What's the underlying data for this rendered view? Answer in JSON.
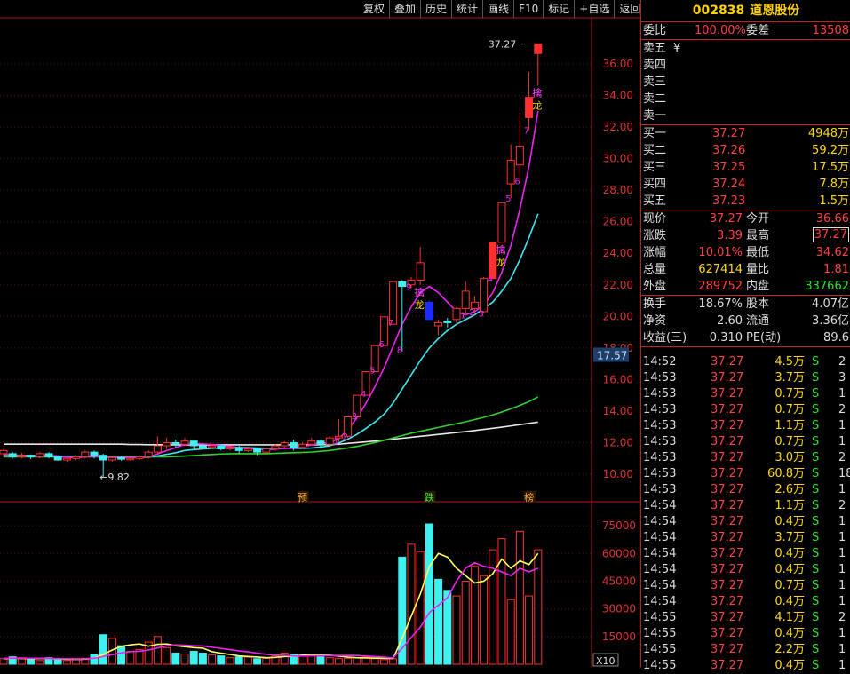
{
  "toolbar": {
    "items": [
      "复权",
      "叠加",
      "历史",
      "统计",
      "画线",
      "F10",
      "标记",
      "+自选",
      "返回"
    ]
  },
  "stock": {
    "code": "002838",
    "name": "道恩股份",
    "weibi_label": "委比",
    "weibi": "100.00%",
    "weicha_label": "委差",
    "weicha": "13508",
    "sell": [
      {
        "label": "卖五",
        "price": "",
        "vol": "",
        "mark": "¥"
      },
      {
        "label": "卖四",
        "price": "",
        "vol": ""
      },
      {
        "label": "卖三",
        "price": "",
        "vol": ""
      },
      {
        "label": "卖二",
        "price": "",
        "vol": ""
      },
      {
        "label": "卖一",
        "price": "",
        "vol": ""
      }
    ],
    "buy": [
      {
        "label": "买一",
        "price": "37.27",
        "vol": "4948万"
      },
      {
        "label": "买二",
        "price": "37.26",
        "vol": "59.2万"
      },
      {
        "label": "买三",
        "price": "37.25",
        "vol": "17.5万"
      },
      {
        "label": "买四",
        "price": "37.24",
        "vol": "7.8万"
      },
      {
        "label": "买五",
        "price": "37.23",
        "vol": "1.5万"
      }
    ],
    "stats": [
      {
        "l1": "现价",
        "v1": "37.27",
        "l2": "今开",
        "v2": "36.66",
        "c1": "red",
        "c2": "red"
      },
      {
        "l1": "涨跌",
        "v1": "3.39",
        "l2": "最高",
        "v2": "37.27",
        "c1": "red",
        "c2": "red",
        "boxed2": true
      },
      {
        "l1": "涨幅",
        "v1": "10.01%",
        "l2": "最低",
        "v2": "34.62",
        "c1": "red",
        "c2": "red"
      },
      {
        "l1": "总量",
        "v1": "627414",
        "l2": "量比",
        "v2": "1.81",
        "c1": "yel",
        "c2": "red"
      },
      {
        "l1": "外盘",
        "v1": "289752",
        "l2": "内盘",
        "v2": "337662",
        "c1": "red",
        "c2": "grn"
      }
    ],
    "stats2": [
      {
        "l1": "换手",
        "v1": "18.67%",
        "l2": "股本",
        "v2": "4.07亿"
      },
      {
        "l1": "净资",
        "v1": "2.60",
        "l2": "流通",
        "v2": "3.36亿"
      },
      {
        "l1": "收益(三)",
        "v1": "0.310",
        "l2": "PE(动)",
        "v2": "89.6"
      }
    ],
    "trades": [
      {
        "t": "14:52",
        "p": "37.27",
        "v": "4.5万",
        "s": "S",
        "n": "2"
      },
      {
        "t": "14:53",
        "p": "37.27",
        "v": "3.7万",
        "s": "S",
        "n": "3"
      },
      {
        "t": "14:53",
        "p": "37.27",
        "v": "0.7万",
        "s": "S",
        "n": "1"
      },
      {
        "t": "14:53",
        "p": "37.27",
        "v": "0.7万",
        "s": "S",
        "n": "2"
      },
      {
        "t": "14:53",
        "p": "37.27",
        "v": "1.1万",
        "s": "S",
        "n": "1"
      },
      {
        "t": "14:53",
        "p": "37.27",
        "v": "0.7万",
        "s": "S",
        "n": "1"
      },
      {
        "t": "14:53",
        "p": "37.27",
        "v": "3.0万",
        "s": "S",
        "n": "2"
      },
      {
        "t": "14:53",
        "p": "37.27",
        "v": "60.8万",
        "s": "S",
        "n": "18"
      },
      {
        "t": "14:53",
        "p": "37.27",
        "v": "2.6万",
        "s": "S",
        "n": "1"
      },
      {
        "t": "14:54",
        "p": "37.27",
        "v": "1.1万",
        "s": "S",
        "n": "2"
      },
      {
        "t": "14:54",
        "p": "37.27",
        "v": "0.4万",
        "s": "S",
        "n": "1"
      },
      {
        "t": "14:54",
        "p": "37.27",
        "v": "3.7万",
        "s": "S",
        "n": "1"
      },
      {
        "t": "14:54",
        "p": "37.27",
        "v": "0.4万",
        "s": "S",
        "n": "1"
      },
      {
        "t": "14:54",
        "p": "37.27",
        "v": "0.4万",
        "s": "S",
        "n": "1"
      },
      {
        "t": "14:54",
        "p": "37.27",
        "v": "0.7万",
        "s": "S",
        "n": "1"
      },
      {
        "t": "14:54",
        "p": "37.27",
        "v": "0.4万",
        "s": "S",
        "n": "1"
      },
      {
        "t": "14:55",
        "p": "37.27",
        "v": "4.1万",
        "s": "S",
        "n": "2"
      },
      {
        "t": "14:55",
        "p": "37.27",
        "v": "0.4万",
        "s": "S",
        "n": "1"
      },
      {
        "t": "14:55",
        "p": "37.27",
        "v": "2.2万",
        "s": "S",
        "n": "1"
      },
      {
        "t": "14:55",
        "p": "37.27",
        "v": "0.4万",
        "s": "S",
        "n": "1"
      }
    ]
  },
  "chart_data": [
    {
      "type": "candlestick",
      "ylim": [
        9,
        38
      ],
      "y_ticks": [
        "10.00",
        "12.00",
        "14.00",
        "16.00",
        "18.00",
        "20.00",
        "22.00",
        "24.00",
        "26.00",
        "28.00",
        "30.00",
        "32.00",
        "34.00",
        "36.00"
      ],
      "y_tick_values": [
        10,
        12,
        14,
        16,
        18,
        20,
        22,
        24,
        26,
        28,
        30,
        32,
        34,
        36
      ],
      "cursor_price": "17.57",
      "high_label": "37.27",
      "low_label": "9.82",
      "event_markers": [
        "预",
        "跌",
        "榜"
      ],
      "candles": [
        [
          11.3,
          11.5,
          11.1,
          11.6
        ],
        [
          11.3,
          11.1,
          11.0,
          11.4
        ],
        [
          11.1,
          11.2,
          11.0,
          11.35
        ],
        [
          11.2,
          11.1,
          10.95,
          11.25
        ],
        [
          11.1,
          11.3,
          11.0,
          11.4
        ],
        [
          11.3,
          11.1,
          11.0,
          11.4
        ],
        [
          11.1,
          10.9,
          10.85,
          11.15
        ],
        [
          10.9,
          11.0,
          10.8,
          11.1
        ],
        [
          11.0,
          11.1,
          10.9,
          11.2
        ],
        [
          11.1,
          11.4,
          11.0,
          11.5
        ],
        [
          11.4,
          11.2,
          11.0,
          11.5
        ],
        [
          11.2,
          10.9,
          9.82,
          11.3
        ],
        [
          10.9,
          11.05,
          10.8,
          11.1
        ],
        [
          11.05,
          10.95,
          10.85,
          11.15
        ],
        [
          10.95,
          11.0,
          10.85,
          11.1
        ],
        [
          11.0,
          11.1,
          10.9,
          11.2
        ],
        [
          11.1,
          11.4,
          11.0,
          11.5
        ],
        [
          11.4,
          11.8,
          11.3,
          12.4
        ],
        [
          11.8,
          12.0,
          11.6,
          12.3
        ],
        [
          12.0,
          11.9,
          11.7,
          12.2
        ],
        [
          11.9,
          12.1,
          11.8,
          12.3
        ],
        [
          12.1,
          11.8,
          11.6,
          12.1
        ],
        [
          11.8,
          11.7,
          11.6,
          11.9
        ],
        [
          11.7,
          11.8,
          11.6,
          11.9
        ],
        [
          11.8,
          11.6,
          11.5,
          11.9
        ],
        [
          11.6,
          11.7,
          11.5,
          11.8
        ],
        [
          11.7,
          11.5,
          11.3,
          11.8
        ],
        [
          11.5,
          11.6,
          11.4,
          11.7
        ],
        [
          11.6,
          11.4,
          11.2,
          11.7
        ],
        [
          11.4,
          11.6,
          11.3,
          11.7
        ],
        [
          11.6,
          11.8,
          11.5,
          11.9
        ],
        [
          11.8,
          12.0,
          11.7,
          12.1
        ],
        [
          12.0,
          11.7,
          11.5,
          12.2
        ],
        [
          11.7,
          11.9,
          11.6,
          12.0
        ],
        [
          11.9,
          12.1,
          11.8,
          12.3
        ],
        [
          12.1,
          11.9,
          11.7,
          12.2
        ],
        [
          11.9,
          12.3,
          11.8,
          12.4
        ],
        [
          12.3,
          12.4,
          12.0,
          13.5
        ],
        [
          12.4,
          13.63,
          12.3,
          13.63
        ],
        [
          13.63,
          15.0,
          13.6,
          15.0
        ],
        [
          15.0,
          16.5,
          15.0,
          16.5
        ],
        [
          16.5,
          18.15,
          16.5,
          18.15
        ],
        [
          18.15,
          19.97,
          18.15,
          19.97
        ],
        [
          19.5,
          22.2,
          19.5,
          22.2
        ],
        [
          22.2,
          21.9,
          17.8,
          22.3
        ],
        [
          22.0,
          22.3,
          21.8,
          22.5
        ],
        [
          22.3,
          23.4,
          22.0,
          24.4
        ],
        [
          20.9,
          19.8,
          19.8,
          21.0
        ],
        [
          19.4,
          19.6,
          18.8,
          19.8
        ],
        [
          19.7,
          19.6,
          19.3,
          19.9
        ],
        [
          19.8,
          20.5,
          19.5,
          20.6
        ],
        [
          20.5,
          21.6,
          20.1,
          22.2
        ],
        [
          20.5,
          20.9,
          20.3,
          21.3
        ],
        [
          20.3,
          22.4,
          20.2,
          22.5
        ],
        [
          22.4,
          24.7,
          22.4,
          24.7
        ],
        [
          24.7,
          27.2,
          24.7,
          27.2
        ],
        [
          28.4,
          29.9,
          27.5,
          30.9
        ],
        [
          29.6,
          30.8,
          28.6,
          32.9
        ],
        [
          32.6,
          33.88,
          31.8,
          35.5
        ],
        [
          36.66,
          37.27,
          34.62,
          37.27
        ]
      ],
      "ma5": [
        11.25,
        11.22,
        11.18,
        11.15,
        11.15,
        11.17,
        11.12,
        11.08,
        11.04,
        11.1,
        11.15,
        11.08,
        11.06,
        11.08,
        11.05,
        11.07,
        11.12,
        11.28,
        11.5,
        11.68,
        11.88,
        11.93,
        11.92,
        11.88,
        11.82,
        11.76,
        11.68,
        11.62,
        11.58,
        11.56,
        11.58,
        11.64,
        11.66,
        11.74,
        11.85,
        11.96,
        12.0,
        12.26,
        12.82,
        13.56,
        14.49,
        15.56,
        16.73,
        18.1,
        19.5,
        20.6,
        21.5,
        21.9,
        21.5,
        20.9,
        20.3,
        20.1,
        20.3,
        20.7,
        21.5,
        22.8,
        24.5,
        26.8,
        29.5,
        33.0
      ],
      "ma10": [
        11.2,
        11.2,
        11.2,
        11.18,
        11.17,
        11.17,
        11.15,
        11.12,
        11.1,
        11.1,
        11.12,
        11.1,
        11.08,
        11.06,
        11.06,
        11.07,
        11.08,
        11.16,
        11.26,
        11.36,
        11.5,
        11.56,
        11.6,
        11.64,
        11.66,
        11.68,
        11.68,
        11.68,
        11.66,
        11.64,
        11.64,
        11.64,
        11.64,
        11.64,
        11.66,
        11.72,
        11.8,
        11.98,
        12.22,
        12.52,
        12.9,
        13.3,
        13.8,
        14.5,
        15.4,
        16.3,
        17.2,
        18.0,
        18.6,
        19.1,
        19.5,
        19.8,
        20.1,
        20.5,
        20.9,
        21.6,
        22.4,
        23.6,
        25.0,
        26.5
      ],
      "ma20": [
        11.1,
        11.1,
        11.1,
        11.1,
        11.1,
        11.1,
        11.1,
        11.1,
        11.1,
        11.1,
        11.1,
        11.1,
        11.1,
        11.1,
        11.1,
        11.1,
        11.1,
        11.1,
        11.1,
        11.12,
        11.15,
        11.18,
        11.22,
        11.25,
        11.28,
        11.3,
        11.3,
        11.3,
        11.3,
        11.3,
        11.32,
        11.34,
        11.36,
        11.38,
        11.4,
        11.45,
        11.5,
        11.58,
        11.66,
        11.76,
        11.88,
        12.0,
        12.15,
        12.3,
        12.45,
        12.6,
        12.72,
        12.84,
        12.96,
        13.08,
        13.2,
        13.32,
        13.46,
        13.6,
        13.76,
        13.94,
        14.14,
        14.36,
        14.6,
        14.9
      ],
      "ma60": [
        11.9,
        11.9,
        11.9,
        11.9,
        11.9,
        11.9,
        11.9,
        11.9,
        11.9,
        11.9,
        11.9,
        11.9,
        11.9,
        11.9,
        11.88,
        11.88,
        11.87,
        11.87,
        11.86,
        11.86,
        11.86,
        11.86,
        11.86,
        11.86,
        11.86,
        11.86,
        11.86,
        11.86,
        11.86,
        11.86,
        11.86,
        11.86,
        11.86,
        11.86,
        11.86,
        11.87,
        11.88,
        11.9,
        11.95,
        12.0,
        12.05,
        12.1,
        12.16,
        12.22,
        12.28,
        12.34,
        12.4,
        12.46,
        12.52,
        12.58,
        12.64,
        12.7,
        12.77,
        12.84,
        12.91,
        12.98,
        13.06,
        13.14,
        13.22,
        13.3
      ],
      "annotations": [
        {
          "i": 37,
          "label": "1"
        },
        {
          "i": 38,
          "label": "2"
        },
        {
          "i": 39,
          "label": "3"
        },
        {
          "i": 40,
          "label": "4"
        },
        {
          "i": 41,
          "label": "5"
        },
        {
          "i": 42,
          "label": "6"
        },
        {
          "i": 43,
          "label": "7"
        },
        {
          "i": 44,
          "label": "8"
        },
        {
          "i": 45,
          "label": "9"
        },
        {
          "i": 46,
          "label": "擒龙"
        },
        {
          "i": 51,
          "label": "1"
        },
        {
          "i": 52,
          "label": "2"
        },
        {
          "i": 53,
          "label": "3"
        },
        {
          "i": 54,
          "label": "4"
        },
        {
          "i": 55,
          "label": "擒龙"
        },
        {
          "i": 56,
          "label": "5"
        },
        {
          "i": 57,
          "label": "6"
        },
        {
          "i": 58,
          "label": "7"
        },
        {
          "i": 59,
          "label": "擒龙"
        }
      ]
    },
    {
      "type": "bar",
      "ylim": [
        0,
        80000
      ],
      "y_ticks": [
        "15000",
        "30000",
        "45000",
        "60000",
        "75000"
      ],
      "y_tick_values": [
        15000,
        30000,
        45000,
        60000,
        75000
      ],
      "unit_label": "X10",
      "volumes": [
        3000,
        4000,
        3500,
        2500,
        2000,
        3500,
        2800,
        2000,
        3000,
        3200,
        5500,
        16000,
        14000,
        10000,
        7000,
        8000,
        12000,
        15000,
        9000,
        6000,
        5500,
        7000,
        6000,
        5000,
        4500,
        3500,
        4000,
        3800,
        3000,
        3200,
        4500,
        6000,
        5500,
        4800,
        5200,
        4000,
        3500,
        3000,
        3200,
        3500,
        3800,
        3000,
        2500,
        3000,
        58000,
        65000,
        61000,
        76000,
        46000,
        40000,
        37000,
        45000,
        53000,
        48000,
        62000,
        68000,
        35000,
        72000,
        37000,
        62000
      ],
      "up_flags": [
        1,
        0,
        1,
        0,
        1,
        0,
        0,
        1,
        1,
        1,
        0,
        0,
        1,
        0,
        1,
        1,
        1,
        1,
        1,
        0,
        1,
        0,
        0,
        1,
        0,
        1,
        0,
        1,
        0,
        1,
        1,
        1,
        0,
        1,
        1,
        0,
        1,
        1,
        1,
        1,
        1,
        1,
        1,
        1,
        0,
        1,
        1,
        0,
        0,
        0,
        1,
        1,
        1,
        1,
        1,
        1,
        1,
        1,
        1,
        1
      ],
      "ma5": [
        3000,
        3200,
        3100,
        3000,
        3100,
        3100,
        2800,
        2700,
        2600,
        2700,
        3200,
        5300,
        7700,
        9700,
        10500,
        11000,
        9800,
        10800,
        11000,
        10000,
        9500,
        9000,
        8700,
        6800,
        6000,
        5300,
        4500,
        4200,
        3900,
        3500,
        3700,
        4100,
        4400,
        4900,
        5200,
        5100,
        4900,
        4400,
        3800,
        3500,
        3400,
        3300,
        3200,
        3100,
        14000,
        26000,
        38000,
        53000,
        60000,
        58000,
        52000,
        48000,
        44000,
        45000,
        49000,
        57000,
        52000,
        56000,
        54000,
        60000
      ],
      "ma10": [
        3200,
        3200,
        3200,
        3200,
        3200,
        3100,
        3000,
        2950,
        2850,
        2900,
        3200,
        4200,
        5200,
        6200,
        6800,
        7000,
        7700,
        8800,
        10000,
        10500,
        10300,
        10000,
        9900,
        9200,
        8600,
        7900,
        7200,
        6700,
        6000,
        5400,
        5000,
        4800,
        4500,
        4400,
        4600,
        4600,
        4700,
        4700,
        4800,
        4700,
        4400,
        4100,
        3800,
        3400,
        8600,
        14500,
        20000,
        28000,
        32000,
        36000,
        45000,
        52000,
        55000,
        53000,
        52000,
        50000,
        48000,
        52000,
        50000,
        52000
      ]
    }
  ]
}
